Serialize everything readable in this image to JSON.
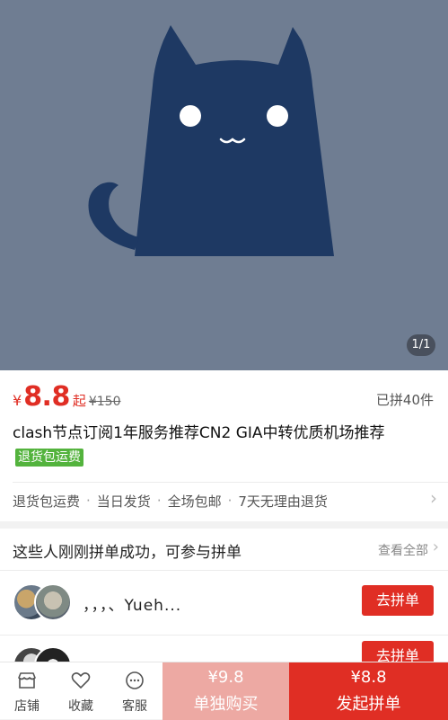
{
  "gallery": {
    "page_indicator": "1/1"
  },
  "product": {
    "currency": "¥",
    "price": "8.8",
    "price_suffix": "起",
    "original_price": "¥150",
    "sold": "已拼40件",
    "title": "clash节点订阅1年服务推荐CN2 GIA中转优质机场推荐",
    "title_tag": "退货包运费",
    "services": [
      "退货包运费",
      "当日发货",
      "全场包邮",
      "7天无理由退货"
    ]
  },
  "group_buy": {
    "header": "这些人刚刚拼单成功，可参与拼单",
    "see_all": "查看全部",
    "rows": [
      {
        "name": "，，，、Yueh...",
        "button": "去拼单"
      },
      {
        "name": "",
        "button": "去拼单"
      }
    ]
  },
  "bottom_bar": {
    "shop": "店铺",
    "favorite": "收藏",
    "service": "客服",
    "single_price": "¥9.8",
    "single_label": "单独购买",
    "group_price": "¥8.8",
    "group_label": "发起拼单"
  },
  "colors": {
    "accent": "#e02e24",
    "tag_green": "#53b33d",
    "hero_bg": "#6f7d92",
    "cat": "#1e3963"
  }
}
